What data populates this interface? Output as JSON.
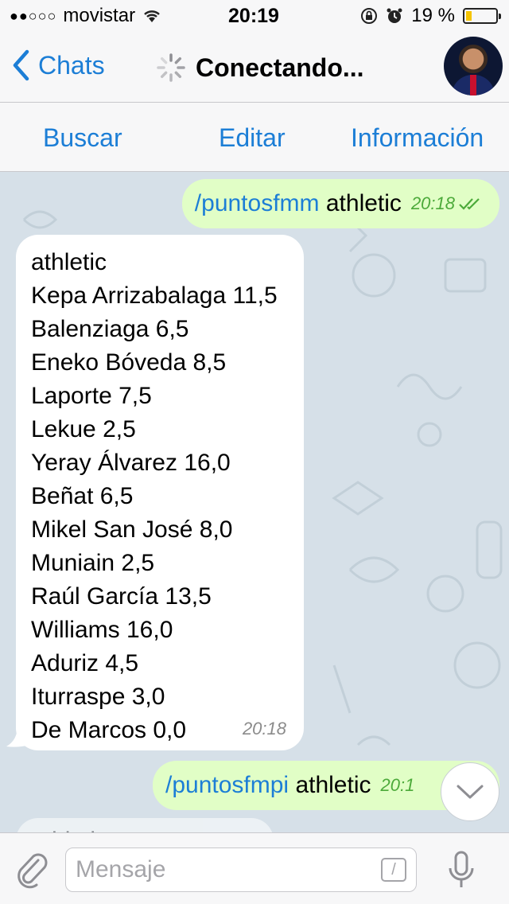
{
  "status_bar": {
    "signal_dots": "●●○○○",
    "carrier": "movistar",
    "time": "20:19",
    "battery_text": "19 %",
    "battery_level": 0.19,
    "battery_color": "#f5c400"
  },
  "nav": {
    "back_label": "Chats",
    "title": "Conectando..."
  },
  "actions": {
    "search": "Buscar",
    "edit": "Editar",
    "info": "Información"
  },
  "messages": [
    {
      "direction": "out",
      "command": "/puntosfmm",
      "text": "athletic",
      "time": "20:18",
      "status": "read"
    },
    {
      "direction": "in",
      "lines": [
        "athletic",
        "Kepa Arrizabalaga 11,5",
        "Balenziaga 6,5",
        "Eneko Bóveda 8,5",
        "Laporte 7,5",
        "Lekue 2,5",
        "Yeray Álvarez 16,0",
        "Beñat 6,5",
        "Mikel San José 8,0",
        "Muniain 2,5",
        "Raúl García 13,5",
        "Williams 16,0",
        "Aduriz 4,5",
        "Iturraspe 3,0",
        "De Marcos 0,0"
      ],
      "time": "20:18"
    },
    {
      "direction": "out",
      "command": "/puntosfmpi",
      "text": "athletic",
      "time": "20:1"
    },
    {
      "direction": "in",
      "partial_text": "athletic"
    }
  ],
  "input": {
    "placeholder": "Mensaje",
    "command_button": "/"
  },
  "colors": {
    "accent": "#1c7ed6",
    "outgoing_bubble": "#e1fec6",
    "chat_background": "#d6e0e8",
    "read_checks": "#4caa3a"
  }
}
